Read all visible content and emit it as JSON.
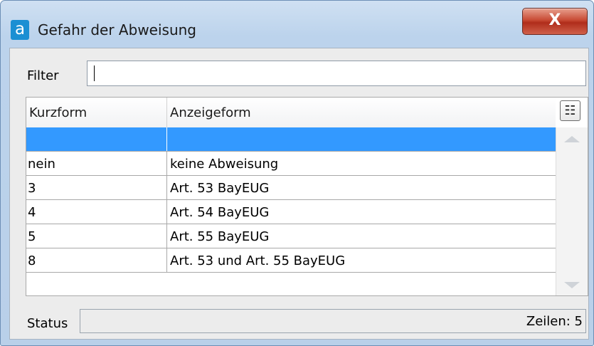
{
  "window": {
    "title": "Gefahr der Abweisung",
    "app_icon_letter": "a",
    "close_label": "X"
  },
  "filter": {
    "label": "Filter",
    "value": ""
  },
  "grid": {
    "columns": [
      "Kurzform",
      "Anzeigeform"
    ],
    "rows": [
      {
        "kurzform": "",
        "anzeigeform": "",
        "selected": true
      },
      {
        "kurzform": "nein",
        "anzeigeform": "keine Abweisung"
      },
      {
        "kurzform": "3",
        "anzeigeform": "Art. 53 BayEUG"
      },
      {
        "kurzform": "4",
        "anzeigeform": "Art. 54 BayEUG"
      },
      {
        "kurzform": "5",
        "anzeigeform": "Art. 55 BayEUG"
      },
      {
        "kurzform": "8",
        "anzeigeform": "Art. 53 und Art. 55 BayEUG"
      }
    ]
  },
  "status": {
    "label": "Status",
    "rows_text": "Zeilen: 5"
  },
  "colors": {
    "selection": "#3399ff",
    "close": "#c84a34",
    "icon": "#1b8fd3"
  }
}
